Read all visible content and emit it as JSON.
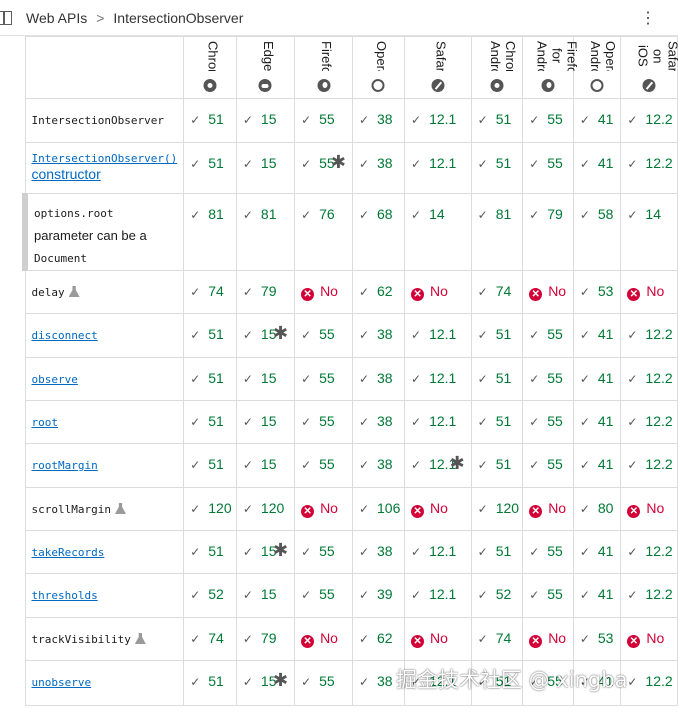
{
  "breadcrumb": {
    "section": "Web APIs",
    "page": "IntersectionObserver",
    "separator": ">"
  },
  "menu_icon": "⋮",
  "browsers": [
    {
      "name": "Chrome",
      "icon": "chrome-icon"
    },
    {
      "name": "Edge",
      "icon": "edge-icon"
    },
    {
      "name": "Firefox",
      "icon": "firefox-icon"
    },
    {
      "name": "Opera",
      "icon": "opera-icon"
    },
    {
      "name": "Safari",
      "icon": "safari-icon"
    },
    {
      "name": "Chrome Android",
      "icon": "chrome-icon"
    },
    {
      "name": "Firefox for Android",
      "icon": "firefox-icon"
    },
    {
      "name": "Opera Android",
      "icon": "opera-icon"
    },
    {
      "name": "Safari on iOS",
      "icon": "safari-icon"
    }
  ],
  "rows": [
    {
      "feature": "IntersectionObserver",
      "type": "code",
      "cells": [
        "51",
        "15",
        "55",
        "38",
        "12.1",
        "51",
        "55",
        "41",
        "12.2"
      ]
    },
    {
      "feature": "IntersectionObserver()",
      "feature_suffix": "constructor",
      "type": "ctor",
      "cells": [
        "51",
        "15",
        "55*",
        "38",
        "12.1",
        "51",
        "55",
        "41",
        "12.2"
      ]
    },
    {
      "feature": "options.root",
      "desc": "parameter can be a",
      "desc_code": "Document",
      "type": "sub",
      "cells": [
        "81",
        "81",
        "76",
        "68",
        "14",
        "81",
        "79",
        "58",
        "14"
      ]
    },
    {
      "feature": "delay",
      "type": "exp",
      "cells": [
        "74",
        "79",
        "No",
        "62",
        "No",
        "74",
        "No",
        "53",
        "No"
      ]
    },
    {
      "feature": "disconnect",
      "type": "link",
      "cells": [
        "51",
        "15*",
        "55",
        "38",
        "12.1",
        "51",
        "55",
        "41",
        "12.2"
      ]
    },
    {
      "feature": "observe",
      "type": "link",
      "cells": [
        "51",
        "15",
        "55",
        "38",
        "12.1",
        "51",
        "55",
        "41",
        "12.2"
      ]
    },
    {
      "feature": "root",
      "type": "link",
      "cells": [
        "51",
        "15",
        "55",
        "38",
        "12.1",
        "51",
        "55",
        "41",
        "12.2"
      ]
    },
    {
      "feature": "rootMargin",
      "type": "link",
      "cells": [
        "51",
        "15",
        "55",
        "38",
        "12.1*",
        "51",
        "55",
        "41",
        "12.2"
      ]
    },
    {
      "feature": "scrollMargin",
      "type": "exp",
      "cells": [
        "120",
        "120",
        "No",
        "106",
        "No",
        "120",
        "No",
        "80",
        "No"
      ]
    },
    {
      "feature": "takeRecords",
      "type": "link",
      "cells": [
        "51",
        "15*",
        "55",
        "38",
        "12.1",
        "51",
        "55",
        "41",
        "12.2"
      ]
    },
    {
      "feature": "thresholds",
      "type": "link",
      "cells": [
        "52",
        "15",
        "55",
        "39",
        "12.1",
        "52",
        "55",
        "41",
        "12.2"
      ]
    },
    {
      "feature": "trackVisibility",
      "type": "exp",
      "cells": [
        "74",
        "79",
        "No",
        "62",
        "No",
        "74",
        "No",
        "53",
        "No"
      ]
    },
    {
      "feature": "unobserve",
      "type": "link",
      "cells": [
        "51",
        "15*",
        "55",
        "38",
        "12.1",
        "51",
        "55",
        "41",
        "12.2"
      ]
    }
  ],
  "watermark": "掘金技术社区 @ xingba",
  "colors": {
    "yes": "#007936",
    "no": "#d30038",
    "link": "#0069c2"
  }
}
